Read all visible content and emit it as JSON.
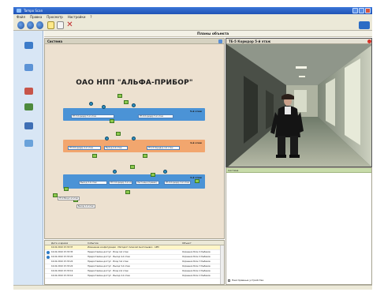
{
  "window": {
    "title": "Tampo Scan"
  },
  "menu": [
    "Файл",
    "Правка",
    "Просмотр",
    "Настройки",
    "?"
  ],
  "plan_header": "Планы объекта",
  "scheme": {
    "panel_title": "Система",
    "title": "ОАО НПП \"АЛЬФА-ПРИБОР\"",
    "floors": [
      {
        "label": "5-й этаж",
        "zones": [
          "ТЕ-5 Коридор 5-й этаж",
          "ТЕ-6 Коридор 5-й этаж"
        ]
      },
      {
        "label": "4-й этаж",
        "zones": [
          "ТЕ-8 Коридор 4-й этаж",
          "Выход 4-й этаж",
          "ТЕ-15 Коридор 4-й этаж"
        ]
      },
      {
        "label": "3-й этаж",
        "zones": [
          "Выход 3-й этаж",
          "ТЕ-5 Коридор 3-й этаж",
          "Лестница (правая)",
          "ТЕ-6 Коридор 3-й этаж"
        ]
      }
    ],
    "cam_labels": [
      "ТЕ-9 Вход 1-й этаж",
      "Выход 1-й этаж"
    ]
  },
  "video": {
    "title": "ТЕ-5 Коридор 5-й этаж"
  },
  "right_panel": {
    "header": "Система",
    "checkbox_label": "Неисправные устройства"
  },
  "events": {
    "columns": [
      "Дата и время",
      "Событие",
      "Объект"
    ],
    "rows": [
      {
        "time": "16.02.2010 15:33:37",
        "event": "Изменение конфигурации · Методист Алексей Анатольевич · АРМ",
        "object": "",
        "highlight": true
      },
      {
        "time": "16.02.2010 15:33:35",
        "event": "Предоставлен доступ · Вход 4-й этаж",
        "object": "Охранник Блок 4 Рыбаков"
      },
      {
        "time": "16.02.2010 15:33:24",
        "event": "Предоставлен доступ · Выход 4-й этаж",
        "object": "Охранник Блок 4 Рыбаков"
      },
      {
        "time": "16.02.2010 15:33:24",
        "event": "Предоставлен доступ · Вход 3-й этаж",
        "object": "Охранник Блок 3 Рыбаков"
      },
      {
        "time": "16.02.2010 15:33:24",
        "event": "Предоставлен доступ · Выход 3-й этаж",
        "object": "Охранник Блок 3 Рыбаков"
      },
      {
        "time": "16.02.2010 15:33:19",
        "event": "Предоставлен доступ · Вход 2-й этаж",
        "object": "Охранник Блок 2 Рыбаков"
      },
      {
        "time": "16.02.2010 15:33:16",
        "event": "Предоставлен доступ · Выход 2-й этаж",
        "object": "Охранник Блок 2 Рыбаков"
      }
    ]
  }
}
